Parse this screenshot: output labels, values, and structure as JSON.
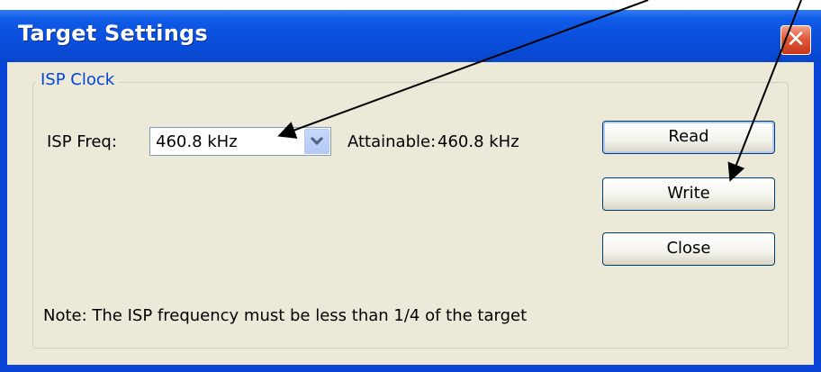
{
  "window": {
    "title": "Target Settings",
    "close_symbol": "✕"
  },
  "group": {
    "legend": "ISP Clock"
  },
  "freq": {
    "label": "ISP Freq:",
    "value": "460.8 kHz",
    "attainable_label": "Attainable:",
    "attainable_value": "460.8 kHz"
  },
  "buttons": {
    "read": "Read",
    "write": "Write",
    "close": "Close"
  },
  "note": "Note: The ISP frequency must be less than 1/4 of the target",
  "icons": {
    "close": "close-icon",
    "dropdown": "chevron-down-icon"
  },
  "colors": {
    "titlebar": "#0a4fdc",
    "client_bg": "#ece9d8",
    "legend_text": "#0046d5",
    "close_button": "#e05a3a"
  }
}
